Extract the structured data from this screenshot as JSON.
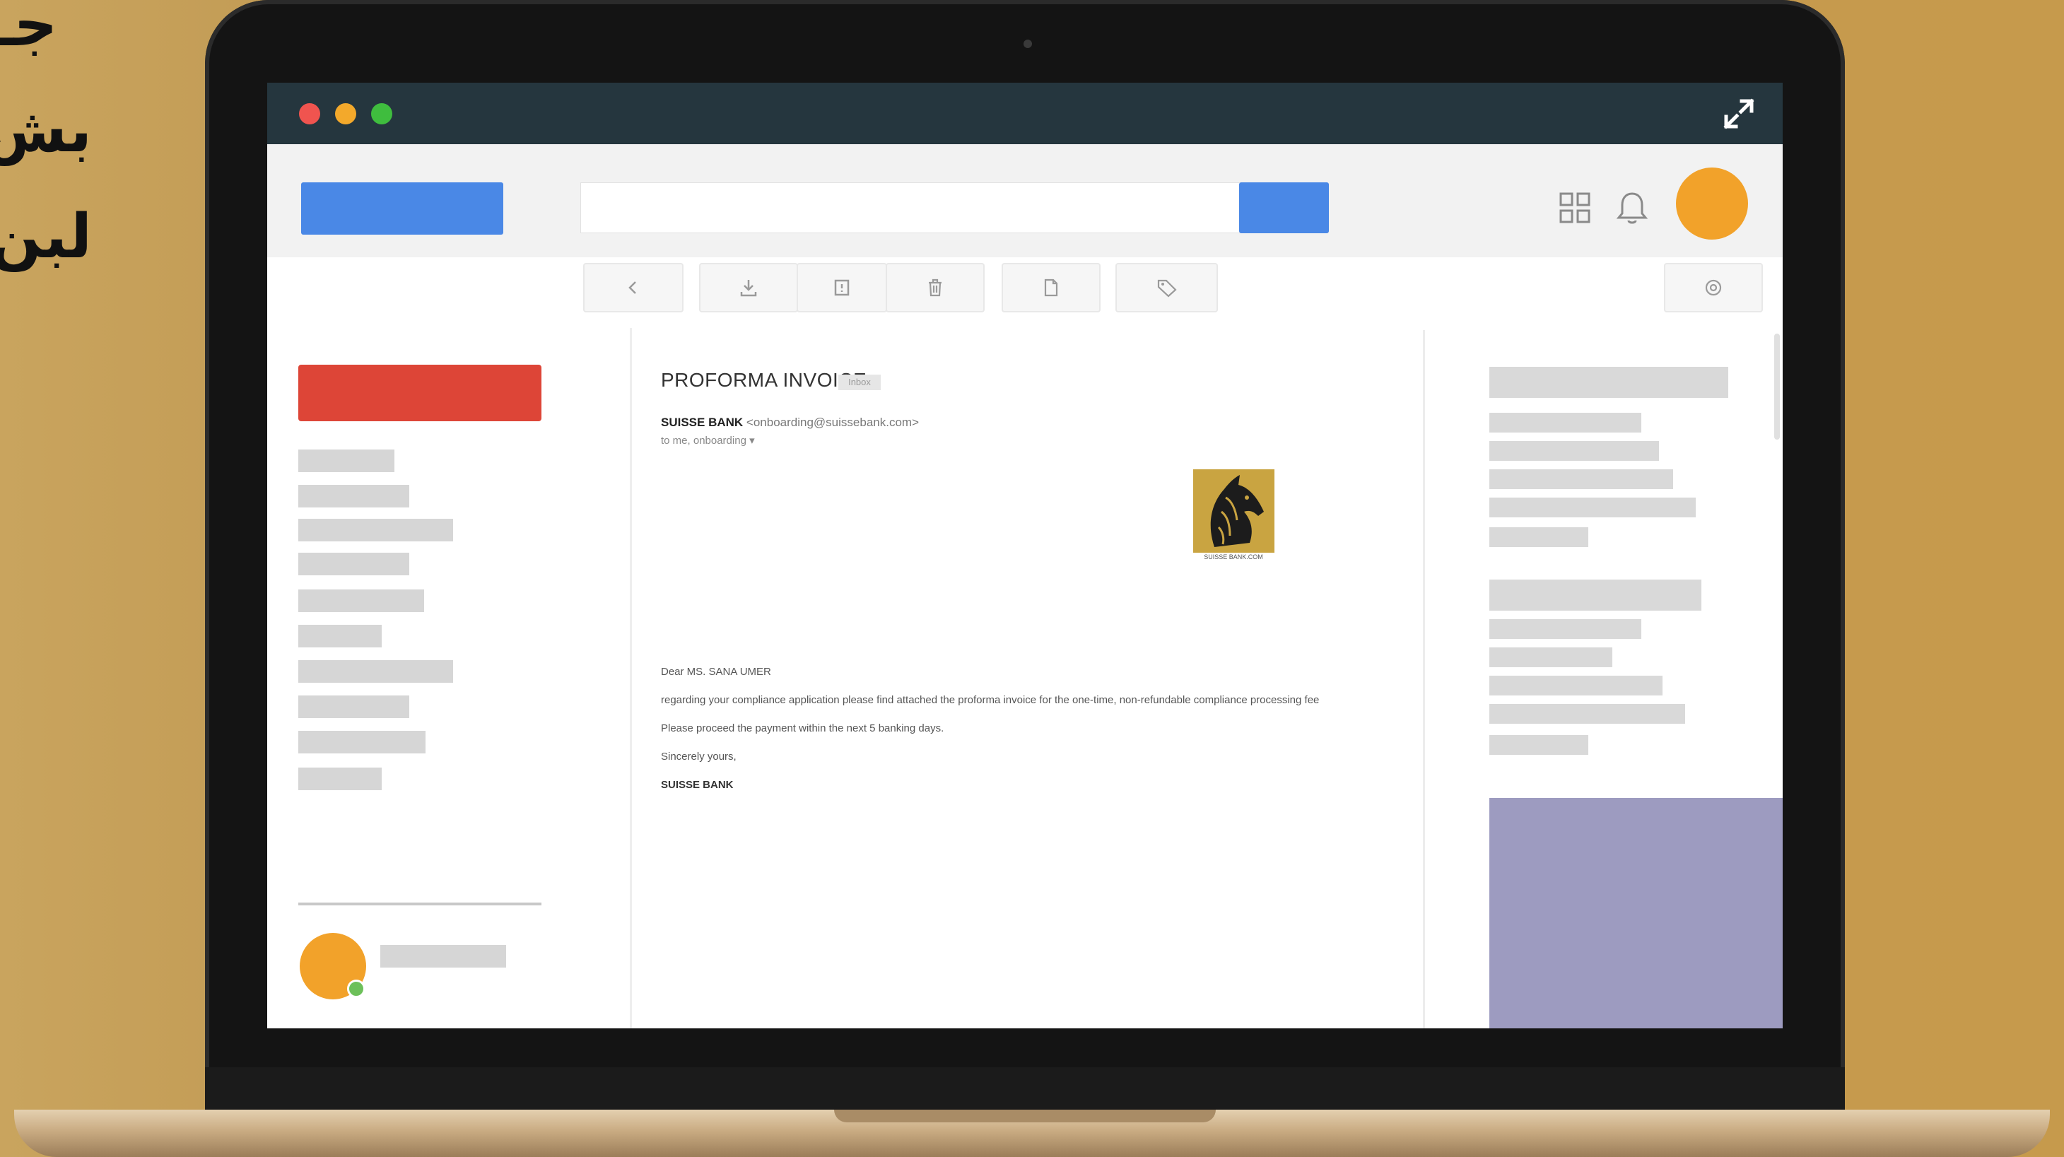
{
  "overlay_text": {
    "arabic_lines": [
      "جـ",
      "بش",
      "لبن"
    ]
  },
  "window": {
    "controls": [
      "close",
      "minimize",
      "maximize"
    ],
    "expand_icon": "expand-arrows-icon"
  },
  "header": {
    "apps_icon": "grid-apps-icon",
    "notifications_icon": "bell-icon",
    "avatar_color": "#f2a22a"
  },
  "toolbar": {
    "buttons": [
      "back",
      "archive",
      "report",
      "delete",
      "move",
      "label"
    ],
    "settings_icon": "gear-icon"
  },
  "email": {
    "subject": "PROFORMA INVOICE",
    "folder_tag": "Inbox",
    "sender_name": "SUISSE BANK",
    "sender_email": "<onboarding@suissebank.com>",
    "to_line": "to me, onboarding ▾",
    "logo_caption": "SUISSE BANK.COM",
    "greeting": "Dear MS. SANA UMER",
    "paragraph_1": "regarding your compliance application please find attached the proforma invoice for the one-time, non-refundable compliance processing fee",
    "paragraph_2": "Please proceed the payment within the next 5 banking days.",
    "closing": "Sincerely yours,",
    "signature": "SUISSE BANK"
  },
  "colors": {
    "compose": "#dd4537",
    "brand_blue": "#4a88e6",
    "titlebar": "#25363e",
    "ad_block": "#9d9bc0",
    "status_online": "#6dc05a",
    "status_away": "#e9d65a"
  }
}
